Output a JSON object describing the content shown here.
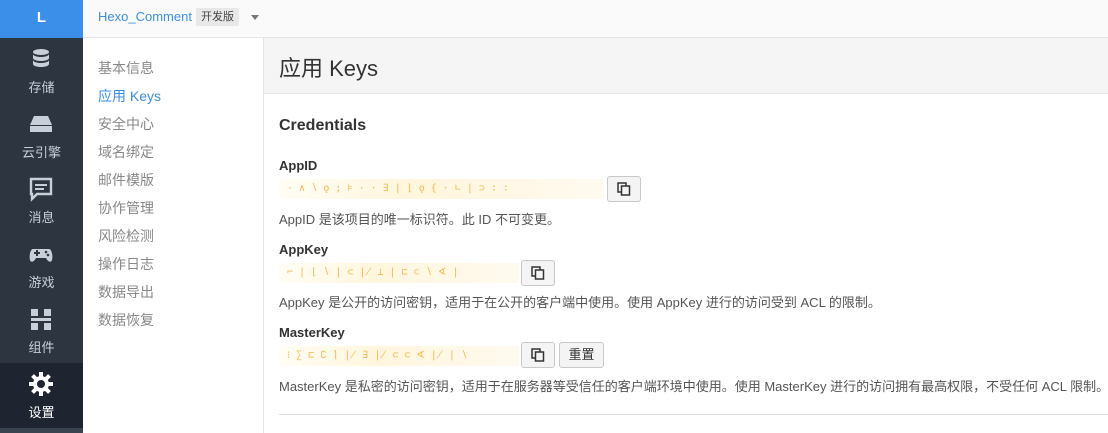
{
  "logo": {
    "letter": "L"
  },
  "rail": [
    {
      "label": "存储",
      "icon": "database-icon"
    },
    {
      "label": "云引擎",
      "icon": "server-icon"
    },
    {
      "label": "消息",
      "icon": "message-icon"
    },
    {
      "label": "游戏",
      "icon": "gamepad-icon"
    },
    {
      "label": "组件",
      "icon": "components-icon"
    },
    {
      "label": "设置",
      "icon": "gear-icon",
      "active": true
    }
  ],
  "topbar": {
    "app_name": "Hexo_Comment",
    "env_badge": "开发版"
  },
  "subnav": [
    {
      "label": "基本信息"
    },
    {
      "label": "应用 Keys",
      "active": true
    },
    {
      "label": "安全中心"
    },
    {
      "label": "域名绑定"
    },
    {
      "label": "邮件模版"
    },
    {
      "label": "协作管理"
    },
    {
      "label": "风险检测"
    },
    {
      "label": "操作日志"
    },
    {
      "label": "数据导出"
    },
    {
      "label": "数据恢复"
    }
  ],
  "page": {
    "title": "应用 Keys",
    "section": "Credentials",
    "appid": {
      "label": "AppID",
      "masked": "·∧∖ǫ;⊧·⋅∃∣⌊ǫ{⋅∟∣⊃∶∶",
      "help": "AppID 是该项目的唯一标识符。此 ID 不可变更。"
    },
    "appkey": {
      "label": "AppKey",
      "masked": "⌐∣⌊∖∣⊂∤⊥∣⊏⊂∖∢∣",
      "help": "AppKey 是公开的访问密钥，适用于在公开的客户端中使用。使用 AppKey 进行的访问受到 ACL 的限制。"
    },
    "masterkey": {
      "label": "MasterKey",
      "masked": "⁝∑⊏∁⌉∤∃∤⊂⊂∢∤∣∖",
      "help": "MasterKey 是私密的访问密钥，适用于在服务器等受信任的客户端环境中使用。使用 MasterKey 进行的访问拥有最高权限，不受任何 ACL 限制。",
      "reset_label": "重置"
    }
  },
  "colors": {
    "accent": "#3b8fe8",
    "rail_bg": "#2d3541",
    "mask": "#f2b94a"
  }
}
